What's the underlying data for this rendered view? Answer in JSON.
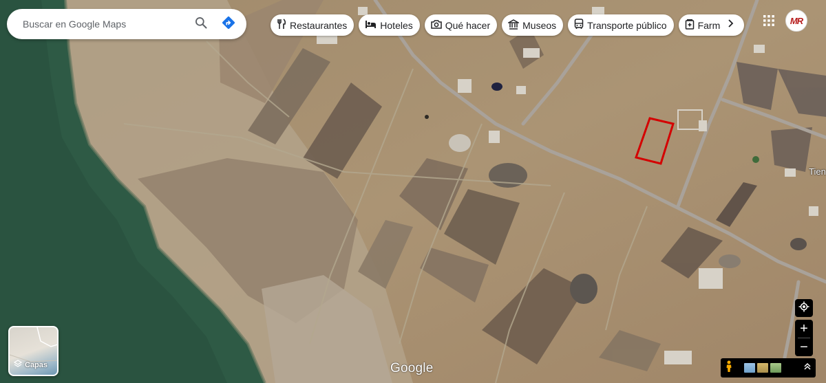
{
  "search": {
    "placeholder": "Buscar en Google Maps",
    "search_icon": "search-icon",
    "directions_icon": "directions-icon"
  },
  "categories": [
    {
      "label": "Restaurantes",
      "icon": "restaurant-icon"
    },
    {
      "label": "Hoteles",
      "icon": "hotel-icon"
    },
    {
      "label": "Qué hacer",
      "icon": "camera-icon"
    },
    {
      "label": "Museos",
      "icon": "museum-icon"
    },
    {
      "label": "Transporte público",
      "icon": "bus-icon"
    },
    {
      "label": "Farmac",
      "icon": "pharmacy-icon"
    }
  ],
  "avatar": {
    "text": "MR"
  },
  "map": {
    "type": "satellite",
    "place_label": "Tien",
    "highlight_color": "#d40000",
    "water_color": "#2e5a45"
  },
  "layers": {
    "label": "Capas"
  },
  "branding": {
    "logo": "Google"
  },
  "colors": {
    "direction_blue": "#1a73e8",
    "text_dark": "#202124"
  }
}
